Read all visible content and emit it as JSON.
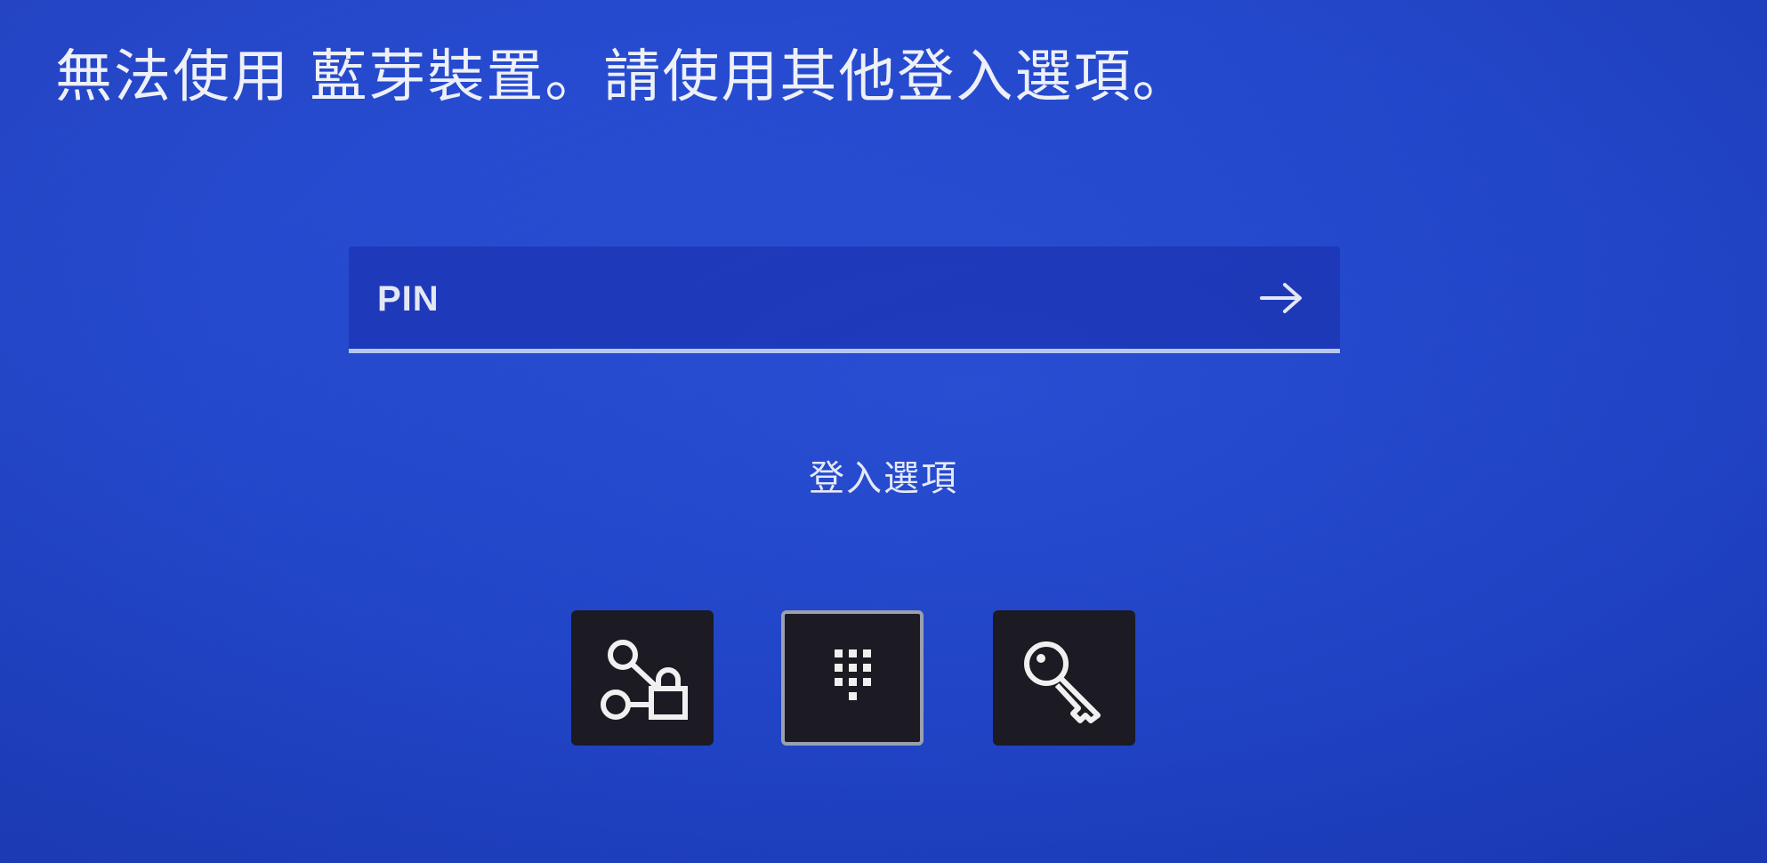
{
  "message": "無法使用 藍芽裝置。請使用其他登入選項。",
  "pin_field": {
    "placeholder": "PIN",
    "submit_icon": "arrow-right-icon"
  },
  "sign_in_options": {
    "label": "登入選項",
    "options": [
      {
        "icon": "bluetooth-lock-icon",
        "selected": false
      },
      {
        "icon": "pin-keypad-icon",
        "selected": true
      },
      {
        "icon": "key-icon",
        "selected": false
      }
    ]
  },
  "colors": {
    "background": "#2246c8",
    "option_tile": "#1c1a22",
    "selected_border": "#9aa0ad",
    "field_underline": "#b9c6f3"
  }
}
